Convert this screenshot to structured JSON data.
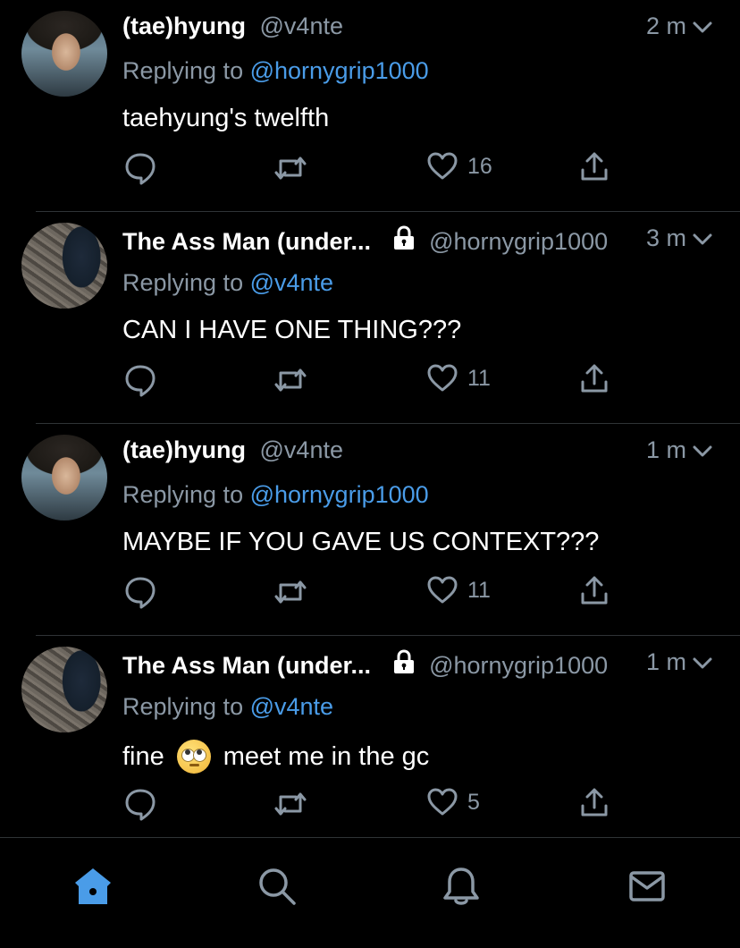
{
  "tweets": [
    {
      "name": "(tae)hyung",
      "handle": "@v4nte",
      "time": "2 m",
      "replying_label": "Replying to",
      "replying_to": "@hornygrip1000",
      "text": "taehyung's twelfth",
      "likes": "16",
      "locked": false
    },
    {
      "name": "The Ass Man (under...",
      "handle": "@hornygrip1000",
      "time": "3 m",
      "replying_label": "Replying to",
      "replying_to": "@v4nte",
      "text": "CAN I HAVE ONE THING???",
      "likes": "11",
      "locked": true
    },
    {
      "name": "(tae)hyung",
      "handle": "@v4nte",
      "time": "1 m",
      "replying_label": "Replying to",
      "replying_to": "@hornygrip1000",
      "text": "MAYBE IF YOU GAVE US CONTEXT???",
      "likes": "11",
      "locked": false
    },
    {
      "name": "The Ass Man (under...",
      "handle": "@hornygrip1000",
      "time": "1 m",
      "replying_label": "Replying to",
      "replying_to": "@v4nte",
      "text_before_emoji": "fine",
      "emoji": "face-with-rolling-eyes",
      "text_after_emoji": "meet me in the gc",
      "likes": "5",
      "locked": true
    }
  ],
  "icons": {
    "reply": "reply-icon",
    "retweet": "retweet-icon",
    "like": "heart-icon",
    "share": "share-icon",
    "menu": "chevron-down-icon",
    "lock": "lock-icon"
  },
  "tabs": [
    {
      "icon": "home-icon",
      "active": true
    },
    {
      "icon": "search-icon",
      "active": false
    },
    {
      "icon": "notifications-icon",
      "active": false
    },
    {
      "icon": "messages-icon",
      "active": false
    }
  ],
  "colors": {
    "background": "#000000",
    "text": "#ffffff",
    "muted": "#8b98a5",
    "link": "#4a9ce8",
    "active_tab": "#4a9ce8",
    "divider": "#2f3336"
  }
}
